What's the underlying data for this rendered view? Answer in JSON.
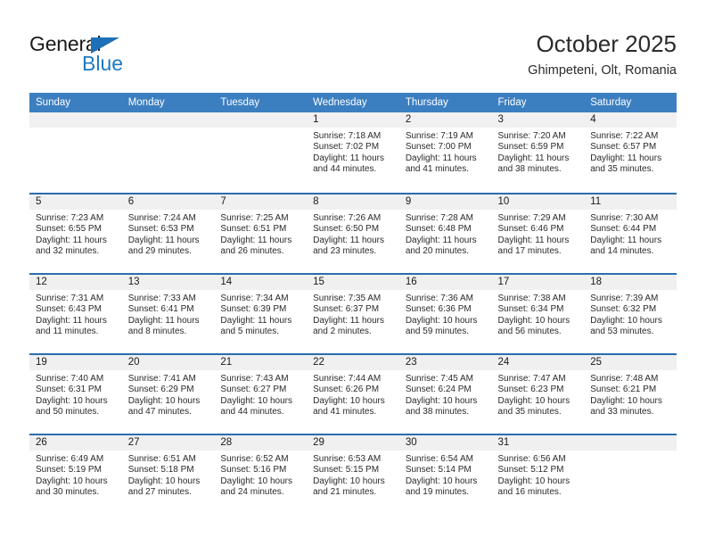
{
  "logo": {
    "word1": "General",
    "word2": "Blue",
    "triangle_color": "#1d6fb7",
    "blue_color": "#1d7ac4"
  },
  "header": {
    "month_title": "October 2025",
    "location": "Ghimpeteni, Olt, Romania"
  },
  "theme": {
    "header_bg": "#3c7fc1",
    "row_divider": "#2a6ead",
    "daynum_band_bg": "#f0f0f0"
  },
  "calendar": {
    "weekday_headers": [
      "Sunday",
      "Monday",
      "Tuesday",
      "Wednesday",
      "Thursday",
      "Friday",
      "Saturday"
    ],
    "weeks": [
      [
        {
          "day": "",
          "sunrise": "",
          "sunset": "",
          "daylight": ""
        },
        {
          "day": "",
          "sunrise": "",
          "sunset": "",
          "daylight": ""
        },
        {
          "day": "",
          "sunrise": "",
          "sunset": "",
          "daylight": ""
        },
        {
          "day": "1",
          "sunrise": "Sunrise: 7:18 AM",
          "sunset": "Sunset: 7:02 PM",
          "daylight": "Daylight: 11 hours and 44 minutes."
        },
        {
          "day": "2",
          "sunrise": "Sunrise: 7:19 AM",
          "sunset": "Sunset: 7:00 PM",
          "daylight": "Daylight: 11 hours and 41 minutes."
        },
        {
          "day": "3",
          "sunrise": "Sunrise: 7:20 AM",
          "sunset": "Sunset: 6:59 PM",
          "daylight": "Daylight: 11 hours and 38 minutes."
        },
        {
          "day": "4",
          "sunrise": "Sunrise: 7:22 AM",
          "sunset": "Sunset: 6:57 PM",
          "daylight": "Daylight: 11 hours and 35 minutes."
        }
      ],
      [
        {
          "day": "5",
          "sunrise": "Sunrise: 7:23 AM",
          "sunset": "Sunset: 6:55 PM",
          "daylight": "Daylight: 11 hours and 32 minutes."
        },
        {
          "day": "6",
          "sunrise": "Sunrise: 7:24 AM",
          "sunset": "Sunset: 6:53 PM",
          "daylight": "Daylight: 11 hours and 29 minutes."
        },
        {
          "day": "7",
          "sunrise": "Sunrise: 7:25 AM",
          "sunset": "Sunset: 6:51 PM",
          "daylight": "Daylight: 11 hours and 26 minutes."
        },
        {
          "day": "8",
          "sunrise": "Sunrise: 7:26 AM",
          "sunset": "Sunset: 6:50 PM",
          "daylight": "Daylight: 11 hours and 23 minutes."
        },
        {
          "day": "9",
          "sunrise": "Sunrise: 7:28 AM",
          "sunset": "Sunset: 6:48 PM",
          "daylight": "Daylight: 11 hours and 20 minutes."
        },
        {
          "day": "10",
          "sunrise": "Sunrise: 7:29 AM",
          "sunset": "Sunset: 6:46 PM",
          "daylight": "Daylight: 11 hours and 17 minutes."
        },
        {
          "day": "11",
          "sunrise": "Sunrise: 7:30 AM",
          "sunset": "Sunset: 6:44 PM",
          "daylight": "Daylight: 11 hours and 14 minutes."
        }
      ],
      [
        {
          "day": "12",
          "sunrise": "Sunrise: 7:31 AM",
          "sunset": "Sunset: 6:43 PM",
          "daylight": "Daylight: 11 hours and 11 minutes."
        },
        {
          "day": "13",
          "sunrise": "Sunrise: 7:33 AM",
          "sunset": "Sunset: 6:41 PM",
          "daylight": "Daylight: 11 hours and 8 minutes."
        },
        {
          "day": "14",
          "sunrise": "Sunrise: 7:34 AM",
          "sunset": "Sunset: 6:39 PM",
          "daylight": "Daylight: 11 hours and 5 minutes."
        },
        {
          "day": "15",
          "sunrise": "Sunrise: 7:35 AM",
          "sunset": "Sunset: 6:37 PM",
          "daylight": "Daylight: 11 hours and 2 minutes."
        },
        {
          "day": "16",
          "sunrise": "Sunrise: 7:36 AM",
          "sunset": "Sunset: 6:36 PM",
          "daylight": "Daylight: 10 hours and 59 minutes."
        },
        {
          "day": "17",
          "sunrise": "Sunrise: 7:38 AM",
          "sunset": "Sunset: 6:34 PM",
          "daylight": "Daylight: 10 hours and 56 minutes."
        },
        {
          "day": "18",
          "sunrise": "Sunrise: 7:39 AM",
          "sunset": "Sunset: 6:32 PM",
          "daylight": "Daylight: 10 hours and 53 minutes."
        }
      ],
      [
        {
          "day": "19",
          "sunrise": "Sunrise: 7:40 AM",
          "sunset": "Sunset: 6:31 PM",
          "daylight": "Daylight: 10 hours and 50 minutes."
        },
        {
          "day": "20",
          "sunrise": "Sunrise: 7:41 AM",
          "sunset": "Sunset: 6:29 PM",
          "daylight": "Daylight: 10 hours and 47 minutes."
        },
        {
          "day": "21",
          "sunrise": "Sunrise: 7:43 AM",
          "sunset": "Sunset: 6:27 PM",
          "daylight": "Daylight: 10 hours and 44 minutes."
        },
        {
          "day": "22",
          "sunrise": "Sunrise: 7:44 AM",
          "sunset": "Sunset: 6:26 PM",
          "daylight": "Daylight: 10 hours and 41 minutes."
        },
        {
          "day": "23",
          "sunrise": "Sunrise: 7:45 AM",
          "sunset": "Sunset: 6:24 PM",
          "daylight": "Daylight: 10 hours and 38 minutes."
        },
        {
          "day": "24",
          "sunrise": "Sunrise: 7:47 AM",
          "sunset": "Sunset: 6:23 PM",
          "daylight": "Daylight: 10 hours and 35 minutes."
        },
        {
          "day": "25",
          "sunrise": "Sunrise: 7:48 AM",
          "sunset": "Sunset: 6:21 PM",
          "daylight": "Daylight: 10 hours and 33 minutes."
        }
      ],
      [
        {
          "day": "26",
          "sunrise": "Sunrise: 6:49 AM",
          "sunset": "Sunset: 5:19 PM",
          "daylight": "Daylight: 10 hours and 30 minutes."
        },
        {
          "day": "27",
          "sunrise": "Sunrise: 6:51 AM",
          "sunset": "Sunset: 5:18 PM",
          "daylight": "Daylight: 10 hours and 27 minutes."
        },
        {
          "day": "28",
          "sunrise": "Sunrise: 6:52 AM",
          "sunset": "Sunset: 5:16 PM",
          "daylight": "Daylight: 10 hours and 24 minutes."
        },
        {
          "day": "29",
          "sunrise": "Sunrise: 6:53 AM",
          "sunset": "Sunset: 5:15 PM",
          "daylight": "Daylight: 10 hours and 21 minutes."
        },
        {
          "day": "30",
          "sunrise": "Sunrise: 6:54 AM",
          "sunset": "Sunset: 5:14 PM",
          "daylight": "Daylight: 10 hours and 19 minutes."
        },
        {
          "day": "31",
          "sunrise": "Sunrise: 6:56 AM",
          "sunset": "Sunset: 5:12 PM",
          "daylight": "Daylight: 10 hours and 16 minutes."
        },
        {
          "day": "",
          "sunrise": "",
          "sunset": "",
          "daylight": ""
        }
      ]
    ]
  }
}
